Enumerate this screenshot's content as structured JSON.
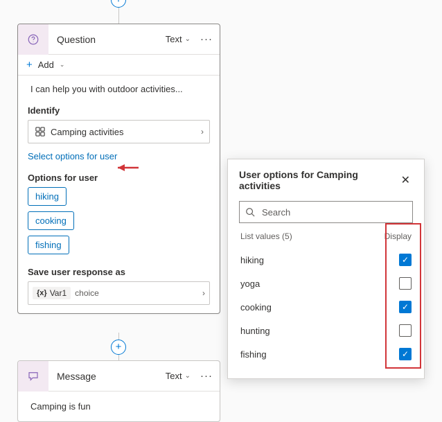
{
  "connector": {
    "add": "+"
  },
  "question_card": {
    "title": "Question",
    "tag": "Text",
    "add_label": "Add",
    "prompt": "I can help you with outdoor activities...",
    "identify_label": "Identify",
    "identify_value": "Camping activities",
    "select_link": "Select options for user",
    "options_label": "Options for user",
    "options": [
      "hiking",
      "cooking",
      "fishing"
    ],
    "save_label": "Save user response as",
    "variable": {
      "name": "Var1",
      "type": "choice"
    }
  },
  "message_card": {
    "title": "Message",
    "tag": "Text",
    "body": "Camping is fun"
  },
  "panel": {
    "title": "User options for Camping activities",
    "search_placeholder": "Search",
    "list_label": "List values (5)",
    "display_label": "Display",
    "rows": [
      {
        "name": "hiking",
        "checked": true
      },
      {
        "name": "yoga",
        "checked": false
      },
      {
        "name": "cooking",
        "checked": true
      },
      {
        "name": "hunting",
        "checked": false
      },
      {
        "name": "fishing",
        "checked": true
      }
    ]
  }
}
